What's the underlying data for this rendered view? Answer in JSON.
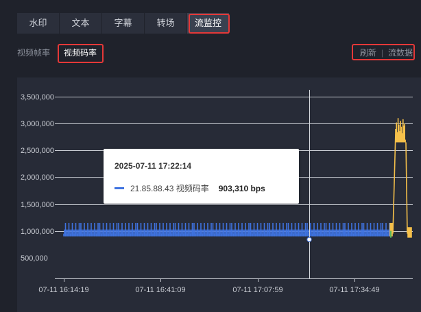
{
  "tabs": [
    {
      "label": "水印",
      "active": false
    },
    {
      "label": "文本",
      "active": false
    },
    {
      "label": "字幕",
      "active": false
    },
    {
      "label": "转场",
      "active": false
    },
    {
      "label": "流监控",
      "active": true
    }
  ],
  "subtabs": {
    "frame_rate": "视频帧率",
    "bitrate": "视频码率"
  },
  "actions": {
    "refresh": "刷新",
    "separator": "|",
    "stream_data": "流数据"
  },
  "tooltip": {
    "time": "2025-07-11 17:22:14",
    "series_label": "21.85.88.43 视频码率",
    "value": "903,310 bps",
    "swatch_color": "#3f73e0"
  },
  "colors": {
    "accent_red": "#e53838",
    "series_blue": "#3f73e0",
    "series_yellow": "#f5c04a"
  },
  "chart_data": {
    "type": "line",
    "y_ticks": [
      "3,500,000",
      "3,000,000",
      "2,500,000",
      "2,000,000",
      "1,500,000",
      "1,000,000",
      "500,000"
    ],
    "x_ticks": [
      "07-11 16:14:19",
      "07-11 16:41:09",
      "07-11 17:07:59",
      "07-11 17:34:49"
    ],
    "ylim": [
      0,
      3500000
    ],
    "series": [
      {
        "name": "21.85.88.43 视频码率",
        "color": "#3f73e0",
        "band_low": 950000,
        "band_high": 1150000,
        "typical": 1000000
      },
      {
        "color": "#f5c04a",
        "segments": [
          {
            "band_low": 950000,
            "band_high": 1150000
          },
          {
            "band_low": 2650000,
            "band_high": 3050000
          }
        ]
      }
    ],
    "cursor_time": "2025-07-11 17:22:14",
    "cursor_value": 903310
  }
}
